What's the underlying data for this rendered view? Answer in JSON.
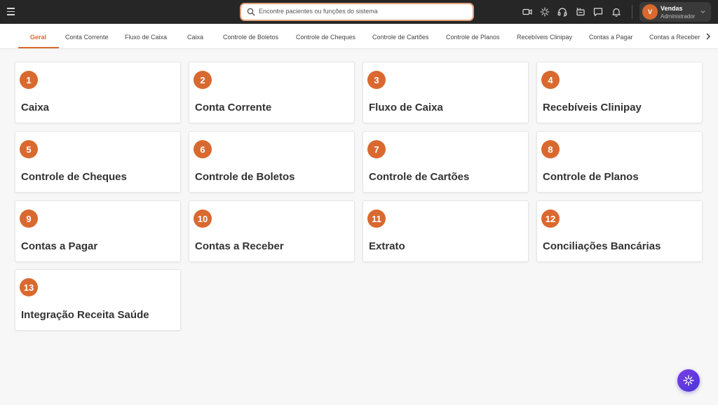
{
  "header": {
    "search_placeholder": "Encontre pacientes ou funções do sistema",
    "user": {
      "initial": "V",
      "name": "Vendas",
      "role": "Administrador"
    }
  },
  "tabs": [
    {
      "label": "Geral",
      "active": true
    },
    {
      "label": "Conta Corrente"
    },
    {
      "label": "Fluxo de Caixa"
    },
    {
      "label": "Caixa"
    },
    {
      "label": "Controle de Boletos"
    },
    {
      "label": "Controle de Cheques"
    },
    {
      "label": "Controle de Cartões"
    },
    {
      "label": "Controle de Planos"
    },
    {
      "label": "Recebíveis Clinipay"
    },
    {
      "label": "Contas a Pagar"
    },
    {
      "label": "Contas a Receber"
    }
  ],
  "cards": [
    {
      "number": "1",
      "title": "Caixa"
    },
    {
      "number": "2",
      "title": "Conta Corrente"
    },
    {
      "number": "3",
      "title": "Fluxo de Caixa"
    },
    {
      "number": "4",
      "title": "Recebíveis Clinipay"
    },
    {
      "number": "5",
      "title": "Controle de Cheques"
    },
    {
      "number": "6",
      "title": "Controle de Boletos"
    },
    {
      "number": "7",
      "title": "Controle de Cartões"
    },
    {
      "number": "8",
      "title": "Controle de Planos"
    },
    {
      "number": "9",
      "title": "Contas a Pagar"
    },
    {
      "number": "10",
      "title": "Contas a Receber"
    },
    {
      "number": "11",
      "title": "Extrato"
    },
    {
      "number": "12",
      "title": "Conciliações Bancárias"
    },
    {
      "number": "13",
      "title": "Integração Receita Saúde"
    }
  ],
  "colors": {
    "accent": "#d9692f",
    "topbar": "#262626",
    "fab": "#5b38e0"
  },
  "icons": [
    "menu-icon",
    "search-icon",
    "video-icon",
    "sparkle-icon",
    "headset-icon",
    "announcement-icon",
    "chat-icon",
    "bell-icon",
    "chevron-down-icon",
    "chevron-right-icon",
    "ai-sparkle-icon"
  ]
}
